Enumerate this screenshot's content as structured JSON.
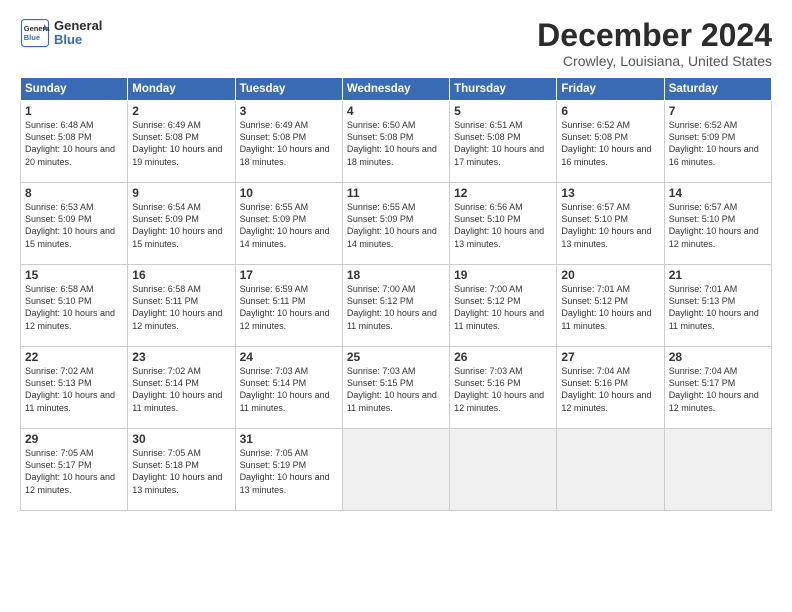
{
  "logo": {
    "line1": "General",
    "line2": "Blue"
  },
  "title": "December 2024",
  "subtitle": "Crowley, Louisiana, United States",
  "days_of_week": [
    "Sunday",
    "Monday",
    "Tuesday",
    "Wednesday",
    "Thursday",
    "Friday",
    "Saturday"
  ],
  "weeks": [
    [
      {
        "day": "1",
        "sunrise": "Sunrise: 6:48 AM",
        "sunset": "Sunset: 5:08 PM",
        "daylight": "Daylight: 10 hours and 20 minutes."
      },
      {
        "day": "2",
        "sunrise": "Sunrise: 6:49 AM",
        "sunset": "Sunset: 5:08 PM",
        "daylight": "Daylight: 10 hours and 19 minutes."
      },
      {
        "day": "3",
        "sunrise": "Sunrise: 6:49 AM",
        "sunset": "Sunset: 5:08 PM",
        "daylight": "Daylight: 10 hours and 18 minutes."
      },
      {
        "day": "4",
        "sunrise": "Sunrise: 6:50 AM",
        "sunset": "Sunset: 5:08 PM",
        "daylight": "Daylight: 10 hours and 18 minutes."
      },
      {
        "day": "5",
        "sunrise": "Sunrise: 6:51 AM",
        "sunset": "Sunset: 5:08 PM",
        "daylight": "Daylight: 10 hours and 17 minutes."
      },
      {
        "day": "6",
        "sunrise": "Sunrise: 6:52 AM",
        "sunset": "Sunset: 5:08 PM",
        "daylight": "Daylight: 10 hours and 16 minutes."
      },
      {
        "day": "7",
        "sunrise": "Sunrise: 6:52 AM",
        "sunset": "Sunset: 5:09 PM",
        "daylight": "Daylight: 10 hours and 16 minutes."
      }
    ],
    [
      {
        "day": "8",
        "sunrise": "Sunrise: 6:53 AM",
        "sunset": "Sunset: 5:09 PM",
        "daylight": "Daylight: 10 hours and 15 minutes."
      },
      {
        "day": "9",
        "sunrise": "Sunrise: 6:54 AM",
        "sunset": "Sunset: 5:09 PM",
        "daylight": "Daylight: 10 hours and 15 minutes."
      },
      {
        "day": "10",
        "sunrise": "Sunrise: 6:55 AM",
        "sunset": "Sunset: 5:09 PM",
        "daylight": "Daylight: 10 hours and 14 minutes."
      },
      {
        "day": "11",
        "sunrise": "Sunrise: 6:55 AM",
        "sunset": "Sunset: 5:09 PM",
        "daylight": "Daylight: 10 hours and 14 minutes."
      },
      {
        "day": "12",
        "sunrise": "Sunrise: 6:56 AM",
        "sunset": "Sunset: 5:10 PM",
        "daylight": "Daylight: 10 hours and 13 minutes."
      },
      {
        "day": "13",
        "sunrise": "Sunrise: 6:57 AM",
        "sunset": "Sunset: 5:10 PM",
        "daylight": "Daylight: 10 hours and 13 minutes."
      },
      {
        "day": "14",
        "sunrise": "Sunrise: 6:57 AM",
        "sunset": "Sunset: 5:10 PM",
        "daylight": "Daylight: 10 hours and 12 minutes."
      }
    ],
    [
      {
        "day": "15",
        "sunrise": "Sunrise: 6:58 AM",
        "sunset": "Sunset: 5:10 PM",
        "daylight": "Daylight: 10 hours and 12 minutes."
      },
      {
        "day": "16",
        "sunrise": "Sunrise: 6:58 AM",
        "sunset": "Sunset: 5:11 PM",
        "daylight": "Daylight: 10 hours and 12 minutes."
      },
      {
        "day": "17",
        "sunrise": "Sunrise: 6:59 AM",
        "sunset": "Sunset: 5:11 PM",
        "daylight": "Daylight: 10 hours and 12 minutes."
      },
      {
        "day": "18",
        "sunrise": "Sunrise: 7:00 AM",
        "sunset": "Sunset: 5:12 PM",
        "daylight": "Daylight: 10 hours and 11 minutes."
      },
      {
        "day": "19",
        "sunrise": "Sunrise: 7:00 AM",
        "sunset": "Sunset: 5:12 PM",
        "daylight": "Daylight: 10 hours and 11 minutes."
      },
      {
        "day": "20",
        "sunrise": "Sunrise: 7:01 AM",
        "sunset": "Sunset: 5:12 PM",
        "daylight": "Daylight: 10 hours and 11 minutes."
      },
      {
        "day": "21",
        "sunrise": "Sunrise: 7:01 AM",
        "sunset": "Sunset: 5:13 PM",
        "daylight": "Daylight: 10 hours and 11 minutes."
      }
    ],
    [
      {
        "day": "22",
        "sunrise": "Sunrise: 7:02 AM",
        "sunset": "Sunset: 5:13 PM",
        "daylight": "Daylight: 10 hours and 11 minutes."
      },
      {
        "day": "23",
        "sunrise": "Sunrise: 7:02 AM",
        "sunset": "Sunset: 5:14 PM",
        "daylight": "Daylight: 10 hours and 11 minutes."
      },
      {
        "day": "24",
        "sunrise": "Sunrise: 7:03 AM",
        "sunset": "Sunset: 5:14 PM",
        "daylight": "Daylight: 10 hours and 11 minutes."
      },
      {
        "day": "25",
        "sunrise": "Sunrise: 7:03 AM",
        "sunset": "Sunset: 5:15 PM",
        "daylight": "Daylight: 10 hours and 11 minutes."
      },
      {
        "day": "26",
        "sunrise": "Sunrise: 7:03 AM",
        "sunset": "Sunset: 5:16 PM",
        "daylight": "Daylight: 10 hours and 12 minutes."
      },
      {
        "day": "27",
        "sunrise": "Sunrise: 7:04 AM",
        "sunset": "Sunset: 5:16 PM",
        "daylight": "Daylight: 10 hours and 12 minutes."
      },
      {
        "day": "28",
        "sunrise": "Sunrise: 7:04 AM",
        "sunset": "Sunset: 5:17 PM",
        "daylight": "Daylight: 10 hours and 12 minutes."
      }
    ],
    [
      {
        "day": "29",
        "sunrise": "Sunrise: 7:05 AM",
        "sunset": "Sunset: 5:17 PM",
        "daylight": "Daylight: 10 hours and 12 minutes."
      },
      {
        "day": "30",
        "sunrise": "Sunrise: 7:05 AM",
        "sunset": "Sunset: 5:18 PM",
        "daylight": "Daylight: 10 hours and 13 minutes."
      },
      {
        "day": "31",
        "sunrise": "Sunrise: 7:05 AM",
        "sunset": "Sunset: 5:19 PM",
        "daylight": "Daylight: 10 hours and 13 minutes."
      },
      null,
      null,
      null,
      null
    ]
  ]
}
